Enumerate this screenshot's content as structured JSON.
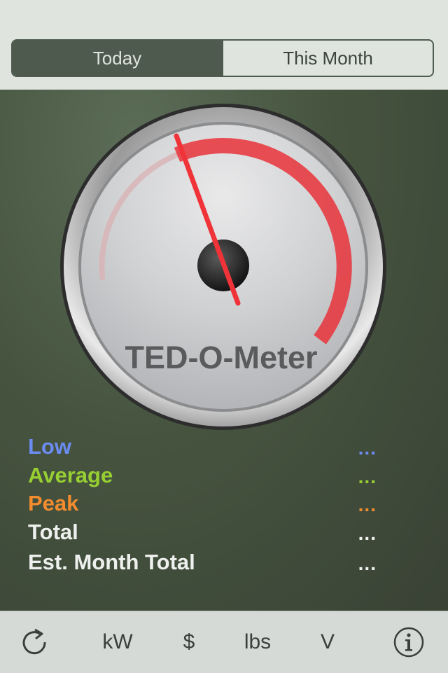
{
  "segmented": {
    "today_label": "Today",
    "month_label": "This Month",
    "selected": "Today"
  },
  "gauge": {
    "title": "TED-O-Meter"
  },
  "stats": [
    {
      "label": "Low",
      "value": "...",
      "color": "#6b8cf0"
    },
    {
      "label": "Average",
      "value": "...",
      "color": "#97cf33"
    },
    {
      "label": "Peak",
      "value": "...",
      "color": "#f28c2e"
    },
    {
      "label": "Total",
      "value": "...",
      "color": "#eef0ee"
    },
    {
      "label": "Est. Month Total",
      "value": "...",
      "color": "#eef0ee"
    }
  ],
  "toolbar": {
    "refresh_icon": "refresh-icon",
    "kw_label": "kW",
    "dollar_label": "$",
    "lbs_label": "lbs",
    "volt_label": "V",
    "info_icon": "info-icon"
  },
  "colors": {
    "accent_red": "#e8333a",
    "panel_green": "#46543f",
    "segment_selected": "#4e5a4d"
  }
}
